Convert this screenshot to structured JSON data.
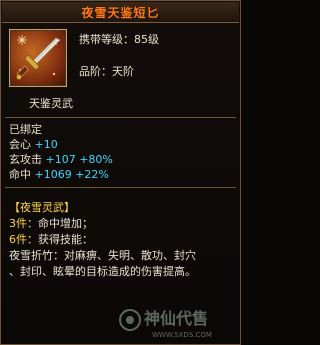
{
  "tooltip": {
    "title": "夜雪天鉴短匕",
    "carry_level_label": "携带等级：",
    "carry_level_value": "85级",
    "grade_label": "品阶：",
    "grade_value": "天阶",
    "section_name": "天鉴灵武",
    "bound_status": "已绑定",
    "stats": [
      {
        "name": "会心",
        "value": "+10",
        "pct": ""
      },
      {
        "name": "玄攻击",
        "value": "+107",
        "pct": "+80%"
      },
      {
        "name": "命中",
        "value": "+1069",
        "pct": "+22%"
      }
    ],
    "set_name": "【夜雪灵武】",
    "set_bonuses": [
      {
        "label": "3件：",
        "text": "命中增加；"
      },
      {
        "label": "6件：",
        "text": "获得技能："
      }
    ],
    "skill_line1": "夜雪折竹：对麻痹、失明、散功、封穴",
    "skill_line2": "、封印、眩晕的目标造成的伤害提高。"
  },
  "watermark": {
    "brand": "神仙代售",
    "url": "WWW.SXDS.COM"
  },
  "colors": {
    "title": "#ff7a1a",
    "stat_value": "#3ad8ff",
    "set_text": "#ffd24a",
    "border": "#6b5438"
  },
  "icons": {
    "item_icon": "dagger-icon"
  }
}
